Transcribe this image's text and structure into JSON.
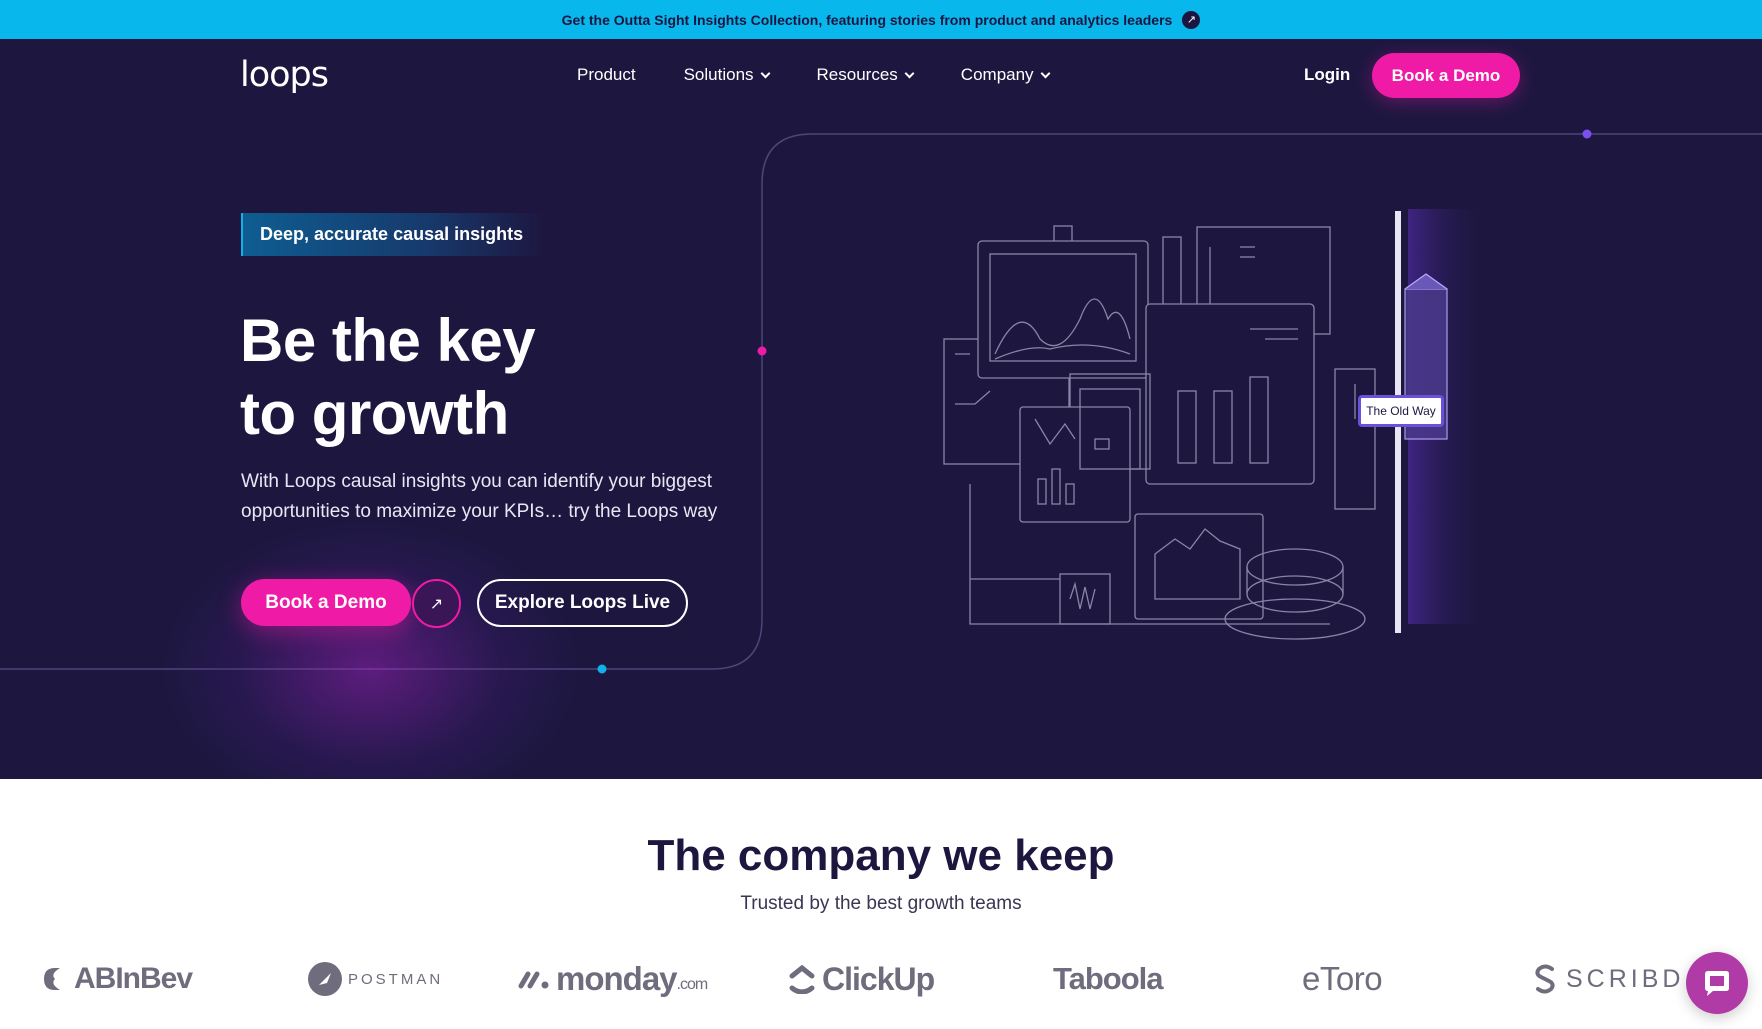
{
  "banner": {
    "text": "Get the Outta Sight Insights Collection, featuring stories from product and analytics leaders",
    "icon": "arrow-up-right-icon"
  },
  "header": {
    "logo": "loops",
    "nav": [
      {
        "label": "Product",
        "has_dropdown": false
      },
      {
        "label": "Solutions",
        "has_dropdown": true
      },
      {
        "label": "Resources",
        "has_dropdown": true
      },
      {
        "label": "Company",
        "has_dropdown": true
      }
    ],
    "login": "Login",
    "demo_button": "Book a Demo"
  },
  "hero": {
    "tagline": "Deep, accurate causal insights",
    "headline_line1": "Be the key",
    "headline_line2": "to growth",
    "subtext": "With Loops causal insights you can identify your biggest opportunities to maximize your KPIs… try the Loops way",
    "demo_button": "Book a Demo",
    "arrow_icon": "arrow-up-right-icon",
    "live_button": "Explore Loops Live",
    "illustration_label": "The Old Way"
  },
  "company": {
    "title": "The company we keep",
    "subtitle": "Trusted by the best growth teams",
    "logos": [
      {
        "name": "ABInBev"
      },
      {
        "name": "POSTMAN"
      },
      {
        "name": "monday",
        "suffix": ".com"
      },
      {
        "name": "ClickUp"
      },
      {
        "name": "Taboola"
      },
      {
        "name": "eToro"
      },
      {
        "name": "SCRIBD"
      }
    ]
  },
  "colors": {
    "banner_bg": "#08b7ec",
    "hero_bg": "#1d1740",
    "accent_pink": "#ef1ba6",
    "accent_purple": "#6b50d8",
    "logo_gray": "#6f6c7d"
  },
  "chat_widget": {
    "icon": "chat-bubble-icon"
  }
}
